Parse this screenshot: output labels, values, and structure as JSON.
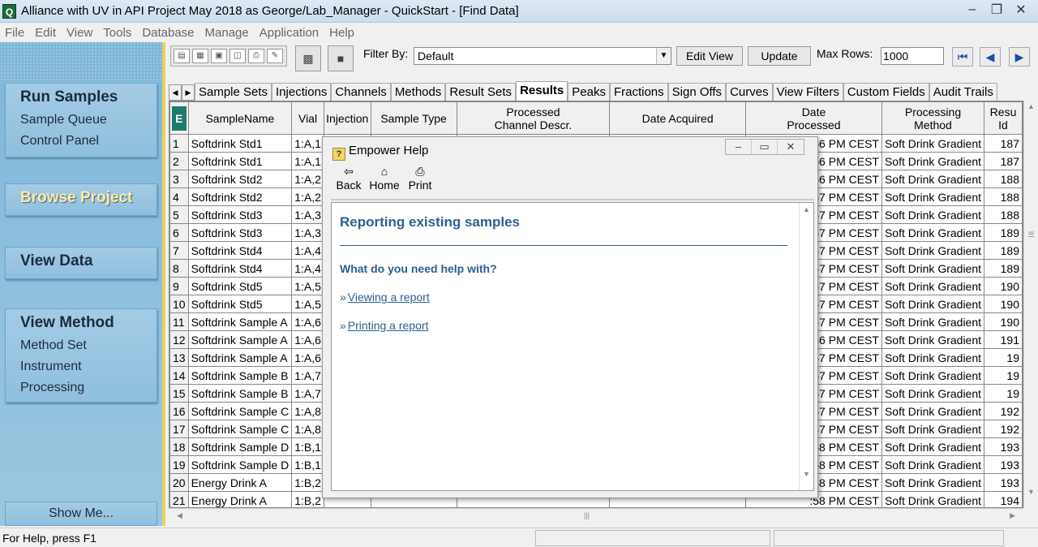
{
  "window": {
    "title": "Alliance with UV in API Project May 2018 as George/Lab_Manager - QuickStart - [Find Data]",
    "app_icon": "Q",
    "controls": [
      "minimize-icon",
      "restore-icon",
      "close-icon"
    ]
  },
  "menu": [
    "File",
    "Edit",
    "View",
    "Tools",
    "Database",
    "Manage",
    "Application",
    "Help"
  ],
  "sidebar": {
    "run_samples": {
      "title": "Run Samples",
      "items": [
        "Sample Queue",
        "Control Panel"
      ]
    },
    "browse_project": {
      "title": "Browse Project"
    },
    "view_data": {
      "title": "View Data"
    },
    "view_method": {
      "title": "View Method",
      "items": [
        "Method Set",
        "Instrument",
        "Processing"
      ]
    },
    "show_me": "Show Me..."
  },
  "toolbar": {
    "filter_label": "Filter By:",
    "filter_value": "Default",
    "edit_view": "Edit View",
    "update": "Update",
    "max_rows_label": "Max Rows:",
    "max_rows_value": "1000"
  },
  "tabs": [
    "Sample Sets",
    "Injections",
    "Channels",
    "Methods",
    "Result Sets",
    "Results",
    "Peaks",
    "Fractions",
    "Sign Offs",
    "Curves",
    "View Filters",
    "Custom Fields",
    "Audit Trails"
  ],
  "active_tab": "Results",
  "table": {
    "columns": [
      "SampleName",
      "Vial",
      "Injection",
      "Sample Type",
      "Processed Channel Descr.",
      "Date Acquired",
      "Date Processed",
      "Processing Method",
      "Resu Id"
    ],
    "col_lines": {
      "processed": [
        "Processed",
        "Channel Descr."
      ],
      "date_processed": [
        "Date",
        "Processed"
      ],
      "processing_method": [
        "Processing",
        "Method"
      ],
      "result_id": [
        "Resu",
        "Id"
      ]
    },
    "rows": [
      {
        "n": "1",
        "name": "Softdrink Std1",
        "vial": "1:A,1",
        "dp": ":56 PM CEST",
        "pm": "Soft Drink Gradient",
        "id": "187"
      },
      {
        "n": "2",
        "name": "Softdrink Std1",
        "vial": "1:A,1",
        "dp": ":56 PM CEST",
        "pm": "Soft Drink Gradient",
        "id": "187"
      },
      {
        "n": "3",
        "name": "Softdrink Std2",
        "vial": "1:A,2",
        "dp": ":56 PM CEST",
        "pm": "Soft Drink Gradient",
        "id": "188"
      },
      {
        "n": "4",
        "name": "Softdrink Std2",
        "vial": "1:A,2",
        "dp": ":57 PM CEST",
        "pm": "Soft Drink Gradient",
        "id": "188"
      },
      {
        "n": "5",
        "name": "Softdrink Std3",
        "vial": "1:A,3",
        "dp": ":57 PM CEST",
        "pm": "Soft Drink Gradient",
        "id": "188"
      },
      {
        "n": "6",
        "name": "Softdrink Std3",
        "vial": "1:A,3",
        "dp": ":57 PM CEST",
        "pm": "Soft Drink Gradient",
        "id": "189"
      },
      {
        "n": "7",
        "name": "Softdrink Std4",
        "vial": "1:A,4",
        "dp": ":57 PM CEST",
        "pm": "Soft Drink Gradient",
        "id": "189"
      },
      {
        "n": "8",
        "name": "Softdrink Std4",
        "vial": "1:A,4",
        "dp": ":57 PM CEST",
        "pm": "Soft Drink Gradient",
        "id": "189"
      },
      {
        "n": "9",
        "name": "Softdrink Std5",
        "vial": "1:A,5",
        "dp": ":57 PM CEST",
        "pm": "Soft Drink Gradient",
        "id": "190"
      },
      {
        "n": "10",
        "name": "Softdrink Std5",
        "vial": "1:A,5",
        "dp": ":57 PM CEST",
        "pm": "Soft Drink Gradient",
        "id": "190"
      },
      {
        "n": "11",
        "name": "Softdrink Sample A",
        "vial": "1:A,6",
        "dp": ":57 PM CEST",
        "pm": "Soft Drink Gradient",
        "id": "190"
      },
      {
        "n": "12",
        "name": "Softdrink Sample A",
        "vial": "1:A,6",
        "dp": ":36 PM CEST",
        "pm": "Soft Drink Gradient",
        "id": "191"
      },
      {
        "n": "13",
        "name": "Softdrink Sample A",
        "vial": "1:A,6",
        "dp": ":57 PM CEST",
        "pm": "Soft Drink Gradient",
        "id": "19"
      },
      {
        "n": "14",
        "name": "Softdrink Sample B",
        "vial": "1:A,7",
        "dp": ":57 PM CEST",
        "pm": "Soft Drink Gradient",
        "id": "19"
      },
      {
        "n": "15",
        "name": "Softdrink Sample B",
        "vial": "1:A,7",
        "dp": ":57 PM CEST",
        "pm": "Soft Drink Gradient",
        "id": "19"
      },
      {
        "n": "16",
        "name": "Softdrink Sample C",
        "vial": "1:A,8",
        "dp": ":57 PM CEST",
        "pm": "Soft Drink Gradient",
        "id": "192"
      },
      {
        "n": "17",
        "name": "Softdrink Sample C",
        "vial": "1:A,8",
        "dp": ":57 PM CEST",
        "pm": "Soft Drink Gradient",
        "id": "192"
      },
      {
        "n": "18",
        "name": "Softdrink Sample D",
        "vial": "1:B,1",
        "dp": ":58 PM CEST",
        "pm": "Soft Drink Gradient",
        "id": "193"
      },
      {
        "n": "19",
        "name": "Softdrink Sample D",
        "vial": "1:B,1",
        "dp": ":58 PM CEST",
        "pm": "Soft Drink Gradient",
        "id": "193"
      },
      {
        "n": "20",
        "name": "Energy Drink A",
        "vial": "1:B,2",
        "dp": ":58 PM CEST",
        "pm": "Soft Drink Gradient",
        "id": "193"
      },
      {
        "n": "21",
        "name": "Energy Drink A",
        "vial": "1:B,2",
        "dp": ":58 PM CEST",
        "pm": "Soft Drink Gradient",
        "id": "194"
      }
    ]
  },
  "help": {
    "title": "Empower Help",
    "back": "Back",
    "home": "Home",
    "print": "Print",
    "heading": "Reporting existing samples",
    "question": "What do you need help with?",
    "links": [
      "Viewing a report",
      "Printing a report"
    ],
    "bullet": "»"
  },
  "status": {
    "text": "For Help, press F1"
  },
  "colors": {
    "sidebar": "#8cbedd",
    "sidebar_border": "#e8d260",
    "help_blue": "#2c5f8f"
  }
}
